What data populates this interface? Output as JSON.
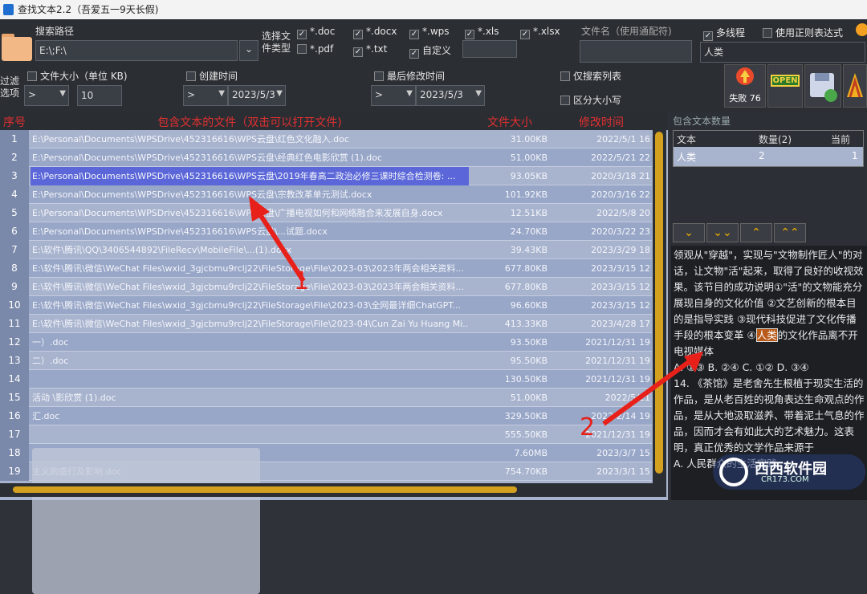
{
  "window": {
    "title": "查找文本2.2（吾爱五一9天长假)"
  },
  "toolbar": {
    "search_path_label": "搜索路径",
    "search_path_value": "E:\\;F:\\",
    "select_type_label": "选择文件类型",
    "types": [
      {
        "label": "*.doc",
        "checked": true
      },
      {
        "label": "*.docx",
        "checked": true
      },
      {
        "label": "*.wps",
        "checked": true
      },
      {
        "label": "*.xls",
        "checked": true
      },
      {
        "label": "*.xlsx",
        "checked": true
      },
      {
        "label": "*.pdf",
        "checked": false
      },
      {
        "label": "*.txt",
        "checked": true
      },
      {
        "label": "自定义",
        "checked": true
      }
    ],
    "filename_label": "文件名（使用通配符)",
    "multithread_label": "多线程",
    "multithread_checked": true,
    "regex_label": "使用正则表达式",
    "regex_checked": false,
    "keyword_value": "人类",
    "filter_label": "过滤选项",
    "filesize_label": "文件大小（单位 KB)",
    "filesize_op": ">",
    "filesize_value": "10",
    "created_label": "创建时间",
    "created_op": ">",
    "created_date": "2023/5/3",
    "modified_label": "最后修改时间",
    "modified_op": ">",
    "modified_date": "2023/5/3",
    "search_list_label": "仅搜索列表",
    "case_label": "区分大小写",
    "fail_label": "失败 76",
    "open_label": "OPEN"
  },
  "grid": {
    "headers": [
      "序号",
      "包含文本的文件（双击可以打开文件)",
      "文件大小",
      "修改时间"
    ],
    "rows": [
      {
        "n": "1",
        "file": "E:\\Personal\\Documents\\WPSDrive\\452316616\\WPS云盘\\红色文化融入.doc",
        "size": "31.00KB",
        "time": "2022/5/1 16"
      },
      {
        "n": "2",
        "file": "E:\\Personal\\Documents\\WPSDrive\\452316616\\WPS云盘\\经典红色电影欣赏 (1).doc",
        "size": "51.00KB",
        "time": "2022/5/21 22"
      },
      {
        "n": "3",
        "file": "E:\\Personal\\Documents\\WPSDrive\\452316616\\WPS云盘\\2019年春高二政治必修三课时综合检测卷: ...",
        "size": "93.05KB",
        "time": "2020/3/18 21"
      },
      {
        "n": "4",
        "file": "E:\\Personal\\Documents\\WPSDrive\\452316616\\WPS云盘\\宗教改革单元测试.docx",
        "size": "101.92KB",
        "time": "2020/3/16 22"
      },
      {
        "n": "5",
        "file": "E:\\Personal\\Documents\\WPSDrive\\452316616\\WPS云盘\\广播电视如何和网络融合来发展自身.docx",
        "size": "12.51KB",
        "time": "2022/5/8 20"
      },
      {
        "n": "6",
        "file": "E:\\Personal\\Documents\\WPSDrive\\452316616\\WPS云盘\\...试题.docx",
        "size": "24.70KB",
        "time": "2020/3/22 23"
      },
      {
        "n": "7",
        "file": "E:\\软件\\腾讯\\QQ\\3406544892\\FileRecv\\MobileFile\\...(1).docx",
        "size": "39.43KB",
        "time": "2023/3/29 18"
      },
      {
        "n": "8",
        "file": "E:\\软件\\腾讯\\微信\\WeChat Files\\wxid_3gjcbmu9rclj22\\FileStorage\\File\\2023-03\\2023年两会相关资料...",
        "size": "677.80KB",
        "time": "2023/3/15 12"
      },
      {
        "n": "9",
        "file": "E:\\软件\\腾讯\\微信\\WeChat Files\\wxid_3gjcbmu9rclj22\\FileStorage\\File\\2023-03\\2023年两会相关资料...",
        "size": "677.80KB",
        "time": "2023/3/15 12"
      },
      {
        "n": "10",
        "file": "E:\\软件\\腾讯\\微信\\WeChat Files\\wxid_3gjcbmu9rclj22\\FileStorage\\File\\2023-03\\全网最详细ChatGPT...",
        "size": "96.60KB",
        "time": "2023/3/15 12"
      },
      {
        "n": "11",
        "file": "E:\\软件\\腾讯\\微信\\WeChat Files\\wxid_3gjcbmu9rclj22\\FileStorage\\File\\2023-04\\Cun Zai Yu Huang Mi...",
        "size": "413.33KB",
        "time": "2023/4/28 17"
      },
      {
        "n": "12",
        "file": "一）.doc",
        "size": "93.50KB",
        "time": "2021/12/31 19"
      },
      {
        "n": "13",
        "file": "二）.doc",
        "size": "95.50KB",
        "time": "2021/12/31 19"
      },
      {
        "n": "14",
        "file": "",
        "size": "130.50KB",
        "time": "2021/12/31 19"
      },
      {
        "n": "15",
        "file": "活动          \\影欣赏 (1).doc",
        "size": "51.00KB",
        "time": "2022/5/21"
      },
      {
        "n": "16",
        "file": "汇.doc",
        "size": "329.50KB",
        "time": "2022/2/14 19"
      },
      {
        "n": "17",
        "file": "",
        "size": "555.50KB",
        "time": "2021/12/31 19"
      },
      {
        "n": "18",
        "file": "",
        "size": "7.60MB",
        "time": "2023/3/7 15"
      },
      {
        "n": "19",
        "file": "主义的盛行及影响.doc",
        "size": "754.70KB",
        "time": "2023/3/1 15"
      }
    ]
  },
  "right": {
    "count_label": "包含文本数量",
    "headers": [
      "文本",
      "数量(2)",
      "当前"
    ],
    "row": {
      "text": "人类",
      "count": "2",
      "current": "1"
    },
    "nav": [
      "⌄",
      "⌄⌄",
      "⌃",
      "⌃⌃"
    ],
    "content_before": "领观从\"穿越\"，实现与\"文物制作匠人\"的对话，让文物\"活\"起来，取得了良好的收视效果。该节目的成功说明①\"活\"的文物能充分展现自身的文化价值 ②文艺创新的根本目的是指导实践 ③现代科技促进了文化传播手段的根本变革 ④",
    "highlight": "人类",
    "content_after": "的文化作品离不开电视媒体",
    "content_options": "A. ①③  B. ②④  C. ①②  D. ③④",
    "content_q14": "14. 《茶馆》是老舍先生根植于现实生活的作品，是从老百姓的视角表达生命观点的作品，是从大地汲取滋养、带着泥土气息的作品，因而才会有如此大的艺术魅力。这表明，真正优秀的文学作品来源于",
    "content_a": "A. 人民群众的生活实践"
  },
  "annotations": {
    "arrow1": "1",
    "arrow2": "2",
    "watermark": "西西软件园",
    "watermark_url": "CR173.COM"
  }
}
